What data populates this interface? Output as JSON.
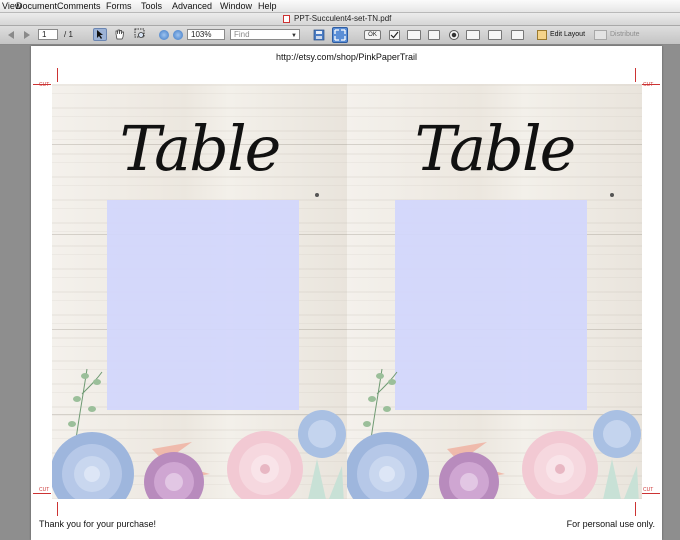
{
  "menu": [
    "View",
    "Document",
    "Comments",
    "Forms",
    "Tools",
    "Advanced",
    "Window",
    "Help"
  ],
  "window": {
    "title": "PPT-Succulent4-set-TN.pdf"
  },
  "toolbar": {
    "page_current": "1",
    "page_total": "/ 1",
    "zoom": "103%",
    "find_placeholder": "Find",
    "ok_label": "OK",
    "edit_layout": "Edit Layout",
    "distribute": "Distribute"
  },
  "page": {
    "header_url": "http://etsy.com/shop/PinkPaperTrail",
    "footer_left": "Thank you for your purchase!",
    "footer_right": "For personal use only.",
    "cards": [
      {
        "heading": "Table"
      },
      {
        "heading": "Table"
      }
    ],
    "cut_label": "CUT",
    "fold_label": "FOLD"
  },
  "colors": {
    "photo_placeholder": "#d2d6fc",
    "wood": "#ece7df",
    "succulent_blue": "#9eb6dd",
    "rose_pink": "#f2c9d3",
    "purple": "#b88bbd"
  }
}
